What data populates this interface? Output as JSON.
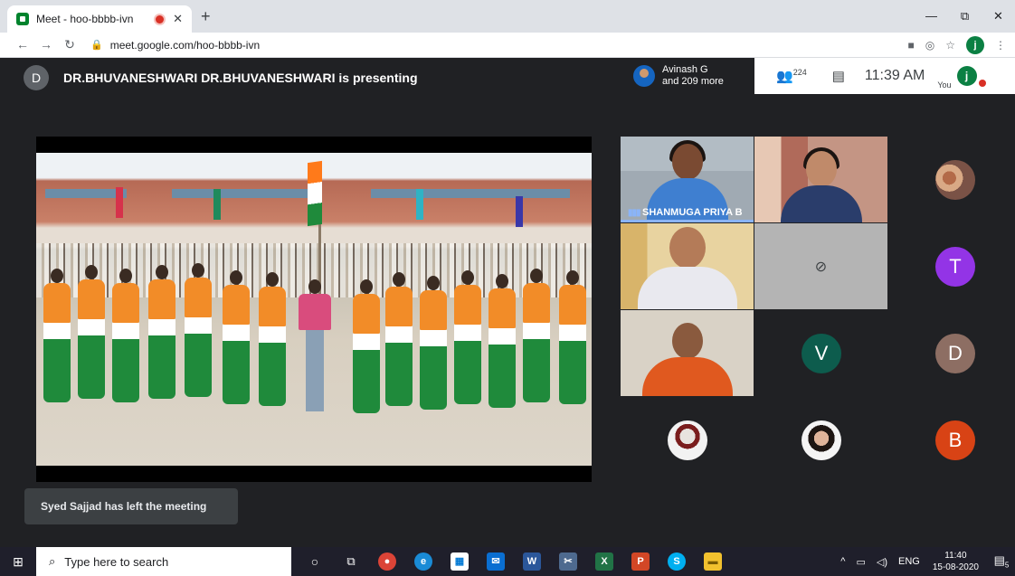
{
  "browser": {
    "tab_title": "Meet - hoo-bbbb-ivn",
    "tab_close": "✕",
    "new_tab": "+",
    "url": "meet.google.com/hoo-bbbb-ivn",
    "minimize": "—",
    "restore": "⧉",
    "close": "✕",
    "profile_initial": "j"
  },
  "meet": {
    "presenter_initial": "D",
    "presenter_text": "DR.BHUVANESHWARI DR.BHUVANESHWARI is presenting",
    "participants_preview": {
      "line1": "Avinash G",
      "line2": "and 209 more"
    },
    "participant_count": "224",
    "time": "11:39 AM",
    "you_label": "You",
    "you_initial": "j",
    "tiles": {
      "speaker_name": "SHANMUGA PRIYA B",
      "letters": [
        "T",
        "V",
        "D",
        "B"
      ]
    },
    "toast": "Syed Sajjad has left the meeting",
    "colors": {
      "t": "#9334e6",
      "v": "#0d5c4d",
      "d": "#8d6e63",
      "b": "#d84315"
    }
  },
  "taskbar": {
    "search_placeholder": "Type here to search",
    "lang": "ENG",
    "time": "11:40",
    "date": "15-08-2020",
    "notif_count": "5"
  }
}
